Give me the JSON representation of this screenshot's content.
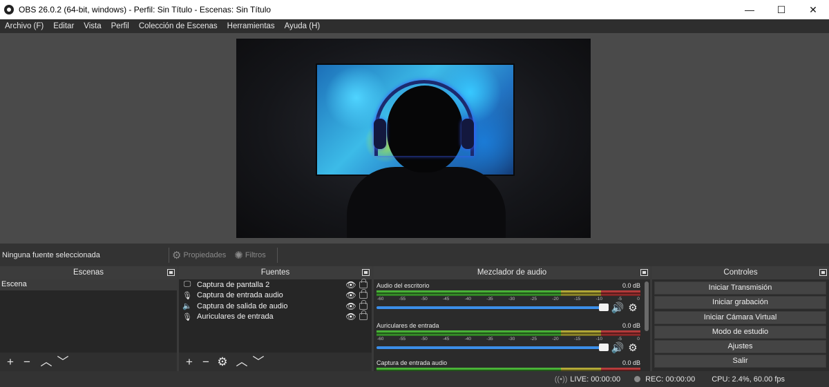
{
  "window": {
    "title": "OBS 26.0.2 (64-bit, windows) - Perfil: Sin Título - Escenas: Sin Título",
    "controls": {
      "minimize": "—",
      "maximize": "☐",
      "close": "✕"
    }
  },
  "menu": [
    "Archivo (F)",
    "Editar",
    "Vista",
    "Perfil",
    "Colección de Escenas",
    "Herramientas",
    "Ayuda (H)"
  ],
  "source_toolbar": {
    "no_selection": "Ninguna fuente seleccionada",
    "properties": "Propiedades",
    "filters": "Filtros"
  },
  "scenes": {
    "title": "Escenas",
    "items": [
      "Escena"
    ]
  },
  "sources": {
    "title": "Fuentes",
    "items": [
      {
        "icon": "monitor-icon",
        "name": "Captura de pantalla 2"
      },
      {
        "icon": "microphone-icon",
        "name": "Captura de entrada audio"
      },
      {
        "icon": "speaker-icon",
        "name": "Captura de salida de audio"
      },
      {
        "icon": "microphone-icon",
        "name": "Auriculares de entrada"
      }
    ]
  },
  "mixer": {
    "title": "Mezclador de audio",
    "scale": [
      "-60",
      "-55",
      "-50",
      "-45",
      "-40",
      "-35",
      "-30",
      "-25",
      "-20",
      "-15",
      "-10",
      "-5",
      "0"
    ],
    "channels": [
      {
        "name": "Audio del escritorio",
        "db": "0.0 dB"
      },
      {
        "name": "Auriculares de entrada",
        "db": "0.0 dB"
      },
      {
        "name": "Captura de entrada audio",
        "db": "0.0 dB"
      }
    ]
  },
  "controls": {
    "title": "Controles",
    "buttons": [
      "Iniciar Transmisión",
      "Iniciar grabación",
      "Iniciar Cámara Virtual",
      "Modo de estudio",
      "Ajustes",
      "Salir"
    ]
  },
  "status": {
    "live": "LIVE: 00:00:00",
    "rec": "REC: 00:00:00",
    "cpu": "CPU: 2.4%, 60.00 fps"
  },
  "colors": {
    "meter_green": "#4fbf3a",
    "meter_yellow": "#bfb43a",
    "meter_red": "#c24040",
    "slider_blue": "#3b8ee8"
  }
}
